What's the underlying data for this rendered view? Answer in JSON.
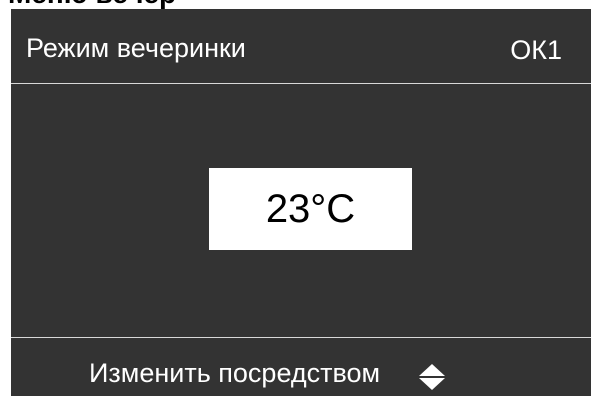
{
  "top_strip": {
    "text": "Меню вечер"
  },
  "header": {
    "title": "Режим вечеринки",
    "code": "ОК1"
  },
  "main": {
    "value": "23°C"
  },
  "footer": {
    "hint": "Изменить посредством",
    "icon": "up-down-arrows-icon"
  },
  "colors": {
    "screen_background": "#333333",
    "text": "#ffffff",
    "value_box": "#ffffff",
    "divider": "#d8d8d8"
  }
}
